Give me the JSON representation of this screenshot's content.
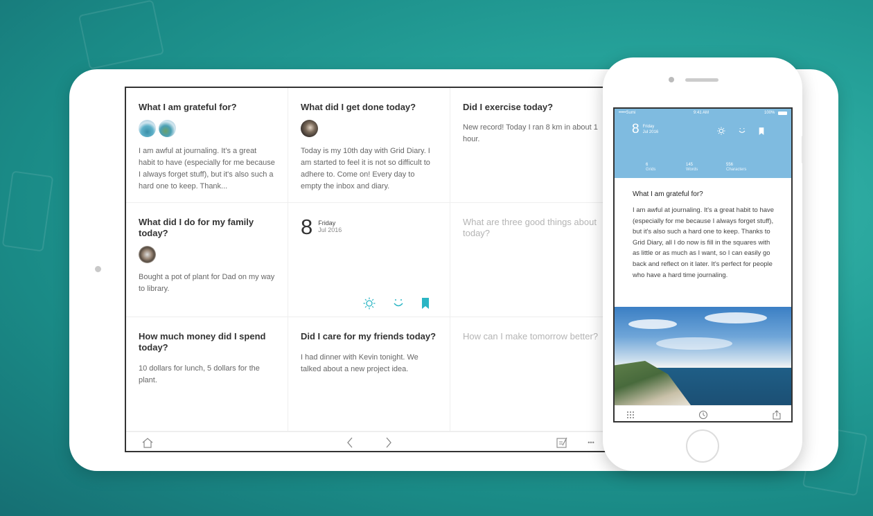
{
  "ipad": {
    "cells": [
      {
        "title": "What I am grateful for?",
        "text": "I am awful at journaling. It's a great habit to have (especially for me because I always forget stuff), but it's also such a hard one to keep. Thank..."
      },
      {
        "title": "What did I get done today?",
        "text": "Today is my 10th day with Grid Diary. I am started to feel it is not so difficult to adhere to. Come on! Every day to empty the inbox and diary."
      },
      {
        "title": "Did I exercise today?",
        "text": "New record! Today I ran 8 km in about 1 hour."
      },
      {
        "title": "What did I do for my family today?",
        "text": "Bought a pot of plant for Dad on my way to library."
      },
      {
        "date_day": "8",
        "weekday": "Friday",
        "month_year": "Jul 2016"
      },
      {
        "placeholder": "What are three good things about today?"
      },
      {
        "title": "How much money did I spend today?",
        "text": "10 dollars for lunch, 5 dollars for the plant."
      },
      {
        "title": "Did I care for my friends today?",
        "text": "I had dinner with Kevin tonight. We talked about a new project idea."
      },
      {
        "placeholder": "How can I make tomorrow better?"
      }
    ],
    "toolbar": {
      "more": "•••"
    }
  },
  "iphone": {
    "status": {
      "carrier": "•••••Sumi",
      "time": "9:41 AM",
      "battery": "100%"
    },
    "date_day": "8",
    "weekday": "Friday",
    "month_year": "Jul 2016",
    "stats": [
      {
        "num": "6",
        "label": "Grids"
      },
      {
        "num": "145",
        "label": "Words"
      },
      {
        "num": "556",
        "label": "Characters"
      }
    ],
    "entry_title": "What I am grateful for?",
    "entry_text": "I am awful at journaling. It's a great habit to have (especially for me because I always forget stuff), but it's also such a hard one to keep. Thanks to Grid Diary, all I do now is fill in the squares with as little or as much as I want, so I can easily go back and reflect on it later. It's perfect for people who have a hard time journaling."
  },
  "colors": {
    "accent": "#2bb5c4",
    "phone_header": "#7fbbe0",
    "background": "#25a199"
  },
  "icons": [
    "home-icon",
    "chevron-left-icon",
    "chevron-right-icon",
    "edit-icon",
    "more-icon",
    "sun-icon",
    "smile-icon",
    "bookmark-icon",
    "grid-icon",
    "history-icon",
    "share-icon"
  ]
}
